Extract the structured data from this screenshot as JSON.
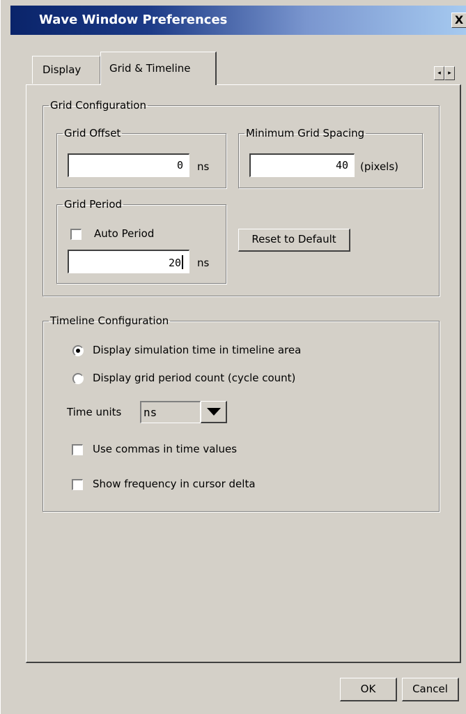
{
  "window": {
    "title": "Wave Window Preferences",
    "close_glyph": "X"
  },
  "tabs": [
    {
      "label": "Display",
      "selected": false
    },
    {
      "label": "Grid & Timeline",
      "selected": true
    }
  ],
  "tab_scroll": {
    "left_glyph": "◂",
    "right_glyph": "▸"
  },
  "grid_config": {
    "legend": "Grid Configuration",
    "offset": {
      "legend": "Grid Offset",
      "value": "0",
      "unit": "ns"
    },
    "min_spacing": {
      "legend": "Minimum Grid Spacing",
      "value": "40",
      "unit": "(pixels)"
    },
    "period": {
      "legend": "Grid Period",
      "auto_label": "Auto Period",
      "auto_checked": false,
      "value": "20",
      "unit": "ns"
    },
    "reset_label": "Reset to Default"
  },
  "timeline_config": {
    "legend": "Timeline Configuration",
    "options": [
      {
        "label": "Display simulation time in timeline area",
        "selected": true
      },
      {
        "label": "Display grid period count (cycle count)",
        "selected": false
      }
    ],
    "time_units_label": "Time units",
    "time_units_value": "ns",
    "commas_label": "Use commas in time values",
    "commas_checked": false,
    "frequency_label": "Show frequency in cursor delta",
    "frequency_checked": false
  },
  "buttons": {
    "ok": "OK",
    "cancel": "Cancel"
  },
  "colors": {
    "face": "#d4d0c8",
    "title_start": "#0a246a",
    "title_end": "#a6caf0"
  }
}
